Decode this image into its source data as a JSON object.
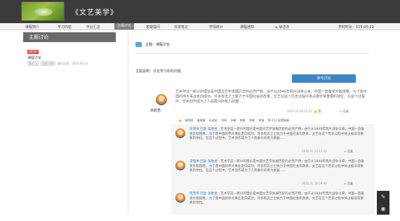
{
  "header": {
    "course_title": "《文艺美学》"
  },
  "nav": {
    "items": [
      "课程简介",
      "学习内容",
      "作业汇总",
      "主题讨论",
      "答疑提问",
      "共享笔记",
      "学情统计",
      "课程通知"
    ],
    "active_index": 3,
    "user_name": "徐洁杰",
    "study_time": "学时时长：105:00:29"
  },
  "sidebar": {
    "title": "主题讨论",
    "tag": "进行中",
    "item": "课程讨论",
    "meta": {
      "b1": "楼主 2",
      "b2": "回帖 256",
      "date": "最后回复：2016-03-31"
    }
  },
  "topic": {
    "head": "主题：课程讨论",
    "desc": "主题说明：讨论学习中的问题",
    "reply_button": "参与讨论"
  },
  "post": {
    "author": "高胜君",
    "text": "艺术学这一新兴的理论是中国文艺学发展历史的必然产物，由于从1840年鸦片战争以来，中国一直备受外敌侵略，为了使中国的伟大事业走向成功，许多有志之士致力于中国社会的改革，文艺在这个历史过程中将占据非常重要的地位。在这个过程中，艺术创作成为了人民群众的有力武器……",
    "time": "2016.01.08 22:12",
    "like": "赞",
    "reply": "回复"
  },
  "likers": {
    "names": [
      "宋明祥",
      "潘翠娥",
      "杜双虹",
      "刘佩",
      "孙雁",
      "李雄",
      "李缘",
      "李瑞",
      "等 11人觉得很棒"
    ]
  },
  "comments": [
    {
      "who": "宋明祥 回复 高胜君：",
      "text": "艺术学这一新兴的理论是中国文艺学发展历史的必然产物，由于从1840年鸦片战争以来，中国一直备受外敌侵略，为了使中国的伟大事业走向成功，许多有志之士致力于中国社会的改革，文艺在这个历史过程中将占据非常重要的地位。在这个过程中，艺术创作成为了人民群众的有力武器……",
      "time": "2016.01.12 17:22",
      "reply": "回复"
    },
    {
      "who": "李理事 回复 高胜君：",
      "text": "艺术学这一新兴的理论是中国文艺学发展历史的必然产物，由于从1840年鸦片战争以来，中国一直备受外敌侵略，为了使中国的伟大事业走向成功，许多有志之士致力于中国社会的改革，文艺在这个历史过程中将占据非常重要的地位。在这个过程中，艺术创作成为了人民群众的有力武器……",
      "time": "2016.01.16 09:49",
      "reply": "回复"
    },
    {
      "who": "周慧琴 回复 高胜君：",
      "text": "艺术学这一新兴的理论是中国文艺学发展历史的必然产物，由于从1840年鸦片战争以来，中国一直备受外敌侵略，为了使中国的伟大事业走向成功，许多有志之士致力于中国社会的改革，文艺在这个历史过程中将占据非常重要的地位。",
      "time": "",
      "reply": ""
    }
  ],
  "floating": {
    "edit_icon": "✎",
    "eye_icon": "◉"
  },
  "colors": {
    "header_bg": "#3b3b3b",
    "accent_blue": "#3d86c6",
    "tag_red": "#e64c3c",
    "thumb_orange": "#e57b2e"
  }
}
